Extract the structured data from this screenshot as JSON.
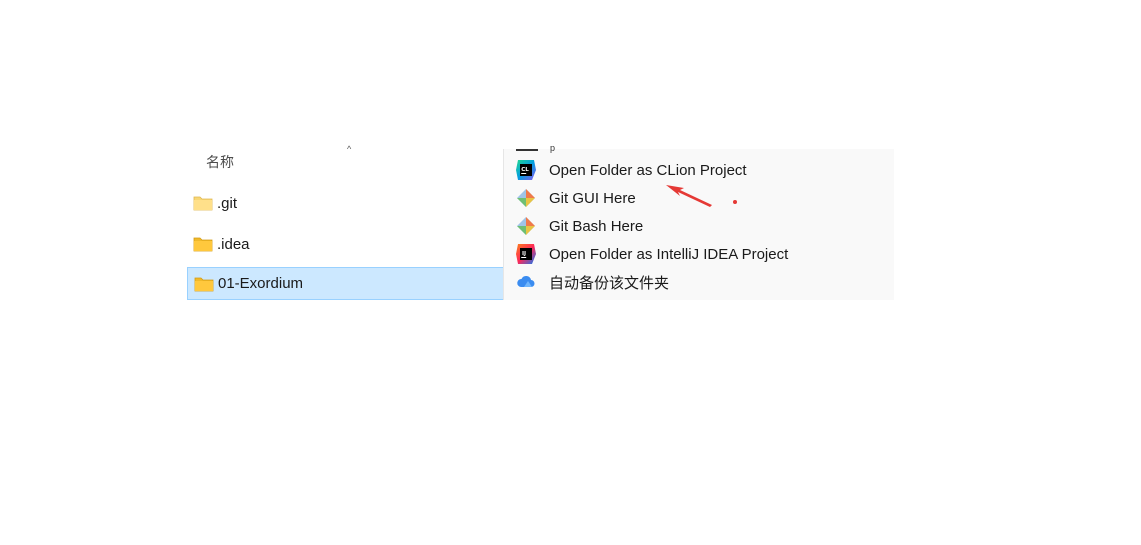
{
  "explorer": {
    "column_header": "名称",
    "sort_indicator": "^",
    "files": [
      {
        "name": ".git",
        "icon": "folder-icon",
        "selected": false
      },
      {
        "name": ".idea",
        "icon": "folder-icon",
        "selected": false
      },
      {
        "name": "01-Exordium",
        "icon": "folder-icon",
        "selected": true
      }
    ]
  },
  "context_menu": {
    "partial_item_text": "p",
    "items": [
      {
        "label": "Open Folder as CLion Project",
        "icon": "clion-icon"
      },
      {
        "label": "Git GUI Here",
        "icon": "git-icon"
      },
      {
        "label": "Git Bash Here",
        "icon": "git-icon"
      },
      {
        "label": "Open Folder as IntelliJ IDEA Project",
        "icon": "intellij-icon"
      },
      {
        "label": "自动备份该文件夹",
        "icon": "cloud-backup-icon"
      }
    ]
  },
  "colors": {
    "selection_bg": "#cce8ff",
    "selection_border": "#99d1ff",
    "menu_bg": "#f9f9f9",
    "annotation_red": "#e53935",
    "folder_yellow": "#ffd865"
  }
}
